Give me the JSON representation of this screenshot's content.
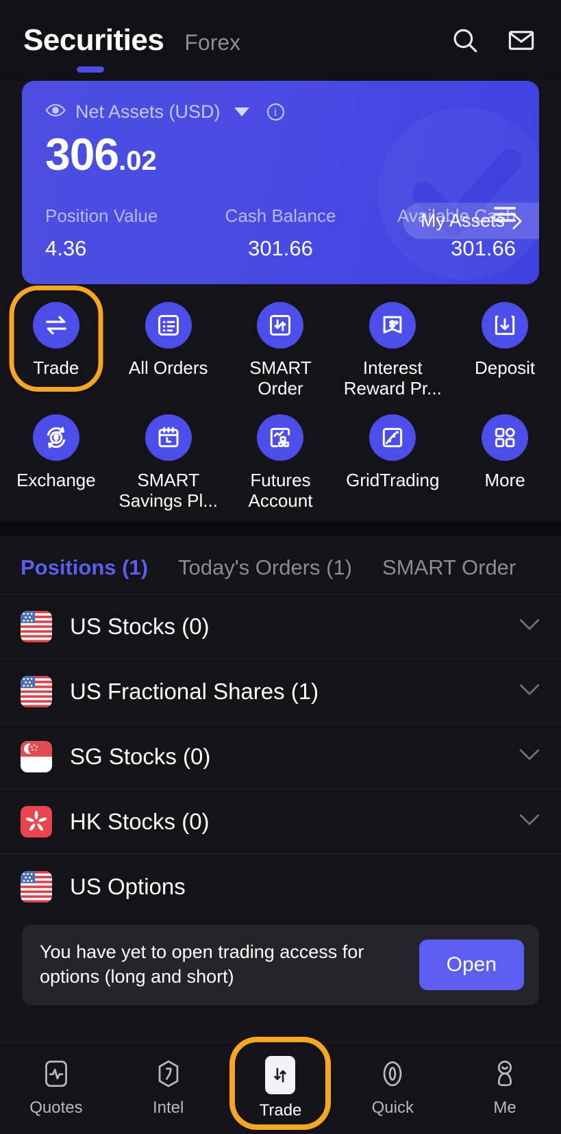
{
  "header": {
    "title": "Securities",
    "alt_tab": "Forex",
    "search_icon": "search-icon",
    "mail_icon": "mail-icon"
  },
  "asset_card": {
    "net_label": "Net Assets (USD)",
    "eye_icon": "eye-icon",
    "caret_icon": "chevron-down-icon",
    "info_icon": "info-icon",
    "amount_int": "306",
    "amount_dec": ".02",
    "my_assets_label": "My Assets",
    "my_assets_chevron": "chevron-right-icon",
    "stats": [
      {
        "label": "Position Value",
        "value": "4.36"
      },
      {
        "label": "Cash Balance",
        "value": "301.66"
      },
      {
        "label": "Available Cash",
        "value": "301.66"
      }
    ],
    "menu_icon": "hamburger-icon",
    "accent": "#4b4ee8"
  },
  "quick_actions": {
    "highlight_color": "#f5a623",
    "row1": [
      {
        "label": "Trade",
        "icon": "swap-arrows-icon",
        "highlighted": true
      },
      {
        "label": "All Orders",
        "icon": "list-document-icon",
        "highlighted": false
      },
      {
        "label": "SMART Order",
        "icon": "up-down-arrows-box-icon",
        "highlighted": false
      },
      {
        "label": "Interest Reward Pr...",
        "icon": "dollar-plus-badge-icon",
        "highlighted": false
      },
      {
        "label": "Deposit",
        "icon": "download-box-icon",
        "highlighted": false
      }
    ],
    "row2": [
      {
        "label": "Exchange",
        "icon": "currency-exchange-icon",
        "highlighted": false
      },
      {
        "label": "SMART Savings Pl...",
        "icon": "calendar-icon",
        "highlighted": false
      },
      {
        "label": "Futures Account",
        "icon": "chart-blocks-icon",
        "highlighted": false
      },
      {
        "label": "GridTrading",
        "icon": "grid-chart-icon",
        "highlighted": false
      },
      {
        "label": "More",
        "icon": "apps-grid-icon",
        "highlighted": false
      }
    ]
  },
  "tabs": [
    {
      "label": "Positions (1)",
      "active": true
    },
    {
      "label": "Today's Orders (1)",
      "active": false
    },
    {
      "label": "SMART Order",
      "active": false
    }
  ],
  "positions": [
    {
      "label": "US Stocks (0)",
      "flag": "us-flag-icon",
      "chevron": true
    },
    {
      "label": "US Fractional Shares (1)",
      "flag": "us-flag-icon",
      "chevron": true
    },
    {
      "label": "SG Stocks (0)",
      "flag": "sg-flag-icon",
      "chevron": true
    },
    {
      "label": "HK Stocks (0)",
      "flag": "hk-flag-icon",
      "chevron": true
    },
    {
      "label": "US Options",
      "flag": "us-flag-icon",
      "chevron": false
    }
  ],
  "notice": {
    "text": "You have yet to open trading access for options (long and short)",
    "button_label": "Open",
    "button_color": "#5b5ef0"
  },
  "bottom_nav": [
    {
      "label": "Quotes",
      "icon": "quotes-waveform-icon",
      "active": false
    },
    {
      "label": "Intel",
      "icon": "intel-hexagon-icon",
      "active": false
    },
    {
      "label": "Trade",
      "icon": "swap-arrows-icon",
      "active": true
    },
    {
      "label": "Quick",
      "icon": "quick-leaf-icon",
      "active": false
    },
    {
      "label": "Me",
      "icon": "person-icon",
      "active": false
    }
  ]
}
